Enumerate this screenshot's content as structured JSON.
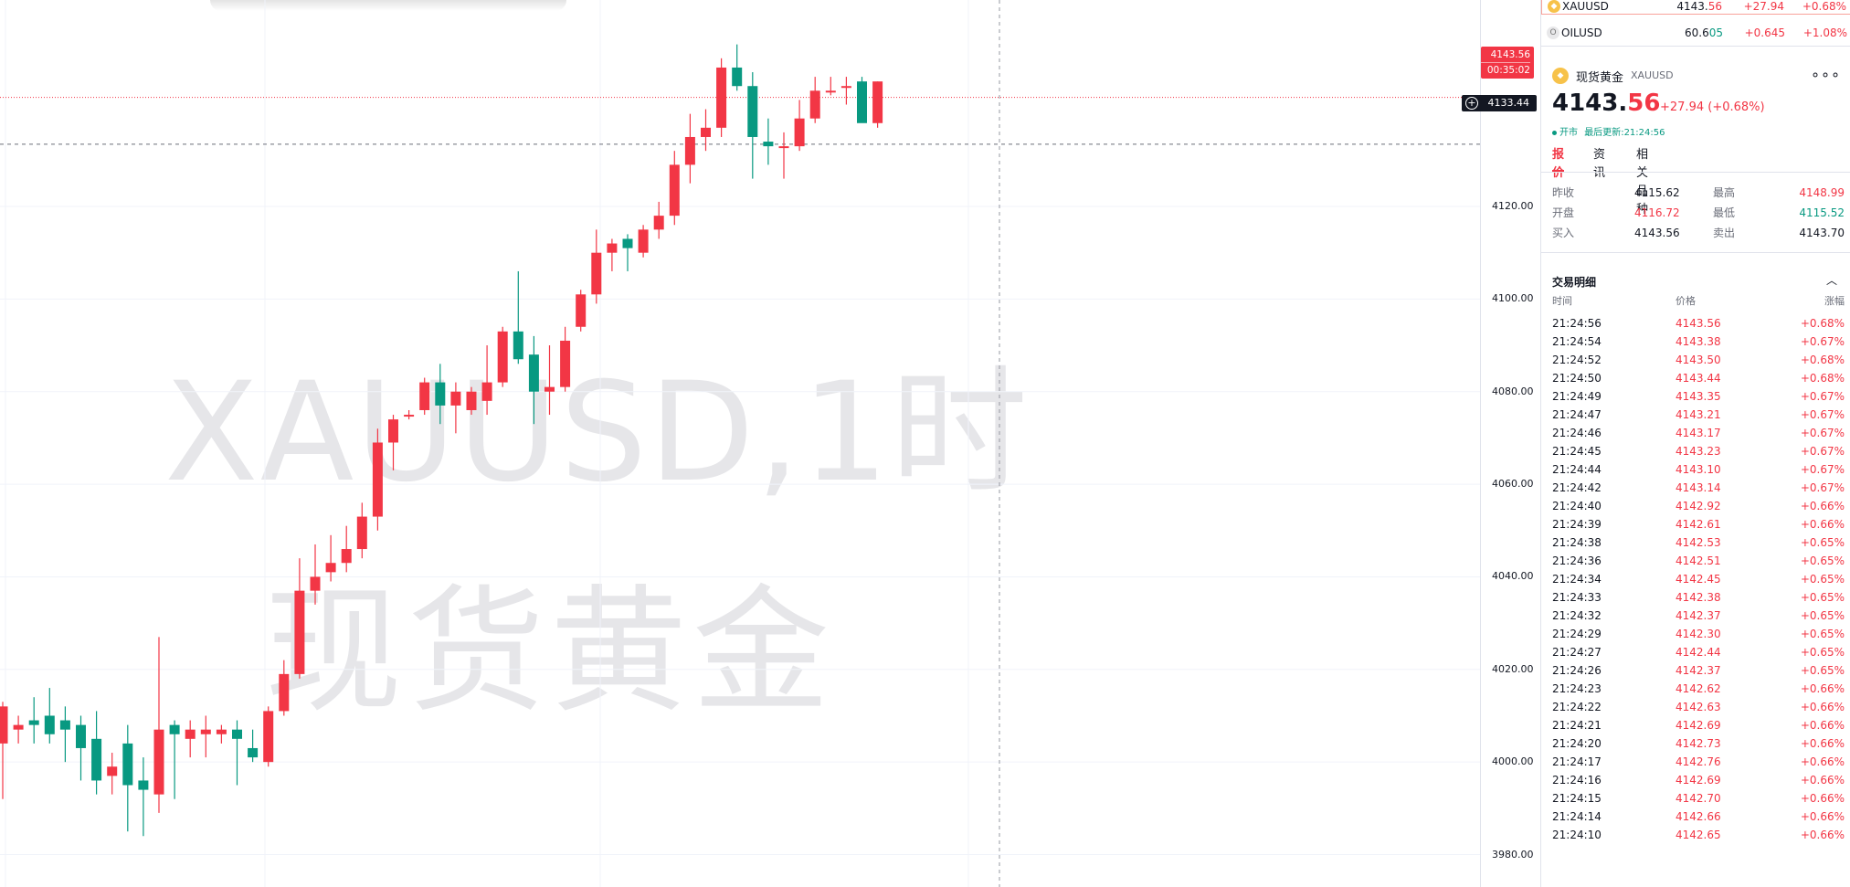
{
  "chart": {
    "symbol": "XAUUSD",
    "watermark_line1": "XAUUSD,1时",
    "watermark_line2": "现货黄金",
    "price_tag": {
      "price": "4143.56",
      "countdown": "00:35:02"
    },
    "crosshair_price": "4133.44",
    "y_ticks": [
      "4120.00",
      "4100.00",
      "4080.00",
      "4060.00",
      "4040.00",
      "4020.00",
      "4000.00",
      "3980.00"
    ],
    "colors": {
      "up": "#f23645",
      "down": "#089981",
      "grid": "#f0f3fa"
    }
  },
  "chart_data": {
    "type": "candlestick",
    "title": "XAUUSD,1时",
    "ylim": [
      3973,
      4164
    ],
    "candles": [
      {
        "o": 4004,
        "h": 4013,
        "l": 3992,
        "c": 4012
      },
      {
        "o": 4007,
        "h": 4010,
        "l": 4004,
        "c": 4008
      },
      {
        "o": 4009,
        "h": 4014,
        "l": 4004,
        "c": 4008
      },
      {
        "o": 4010,
        "h": 4016,
        "l": 4004,
        "c": 4006
      },
      {
        "o": 4009,
        "h": 4012,
        "l": 4000,
        "c": 4007
      },
      {
        "o": 4008,
        "h": 4010,
        "l": 3996,
        "c": 4003
      },
      {
        "o": 4005,
        "h": 4011,
        "l": 3993,
        "c": 3996
      },
      {
        "o": 3997,
        "h": 4002,
        "l": 3993,
        "c": 3999
      },
      {
        "o": 4004,
        "h": 4008,
        "l": 3985,
        "c": 3995
      },
      {
        "o": 3996,
        "h": 4001,
        "l": 3984,
        "c": 3994
      },
      {
        "o": 3993,
        "h": 4027,
        "l": 3989,
        "c": 4007
      },
      {
        "o": 4008,
        "h": 4009,
        "l": 3992,
        "c": 4006
      },
      {
        "o": 4005,
        "h": 4009,
        "l": 4001,
        "c": 4007
      },
      {
        "o": 4006,
        "h": 4010,
        "l": 4001,
        "c": 4007
      },
      {
        "o": 4006,
        "h": 4008,
        "l": 4004,
        "c": 4007
      },
      {
        "o": 4007,
        "h": 4009,
        "l": 3995,
        "c": 4005
      },
      {
        "o": 4003,
        "h": 4007,
        "l": 4000,
        "c": 4001
      },
      {
        "o": 4000,
        "h": 4012,
        "l": 3999,
        "c": 4011
      },
      {
        "o": 4011,
        "h": 4022,
        "l": 4010,
        "c": 4019
      },
      {
        "o": 4019,
        "h": 4044,
        "l": 4018,
        "c": 4037
      },
      {
        "o": 4037,
        "h": 4047,
        "l": 4034,
        "c": 4040
      },
      {
        "o": 4041,
        "h": 4049,
        "l": 4039,
        "c": 4043
      },
      {
        "o": 4043,
        "h": 4051,
        "l": 4041,
        "c": 4046
      },
      {
        "o": 4046,
        "h": 4056,
        "l": 4044,
        "c": 4053
      },
      {
        "o": 4053,
        "h": 4072,
        "l": 4050,
        "c": 4069
      },
      {
        "o": 4069,
        "h": 4075,
        "l": 4063,
        "c": 4074
      },
      {
        "o": 4075,
        "h": 4076,
        "l": 4074,
        "c": 4075
      },
      {
        "o": 4076,
        "h": 4083,
        "l": 4075,
        "c": 4082
      },
      {
        "o": 4082,
        "h": 4086,
        "l": 4073,
        "c": 4077
      },
      {
        "o": 4077,
        "h": 4082,
        "l": 4071,
        "c": 4080
      },
      {
        "o": 4076,
        "h": 4081,
        "l": 4075,
        "c": 4080
      },
      {
        "o": 4078,
        "h": 4090,
        "l": 4075,
        "c": 4082
      },
      {
        "o": 4082,
        "h": 4094,
        "l": 4081,
        "c": 4093
      },
      {
        "o": 4093,
        "h": 4106,
        "l": 4086,
        "c": 4087
      },
      {
        "o": 4088,
        "h": 4092,
        "l": 4073,
        "c": 4080
      },
      {
        "o": 4080,
        "h": 4090,
        "l": 4075,
        "c": 4081
      },
      {
        "o": 4081,
        "h": 4094,
        "l": 4080,
        "c": 4091
      },
      {
        "o": 4094,
        "h": 4102,
        "l": 4093,
        "c": 4101
      },
      {
        "o": 4101,
        "h": 4115,
        "l": 4099,
        "c": 4110
      },
      {
        "o": 4110,
        "h": 4113,
        "l": 4106,
        "c": 4112
      },
      {
        "o": 4113,
        "h": 4114,
        "l": 4106,
        "c": 4111
      },
      {
        "o": 4110,
        "h": 4116,
        "l": 4109,
        "c": 4115
      },
      {
        "o": 4115,
        "h": 4121,
        "l": 4113,
        "c": 4118
      },
      {
        "o": 4118,
        "h": 4132,
        "l": 4116,
        "c": 4129
      },
      {
        "o": 4129,
        "h": 4140,
        "l": 4125,
        "c": 4135
      },
      {
        "o": 4135,
        "h": 4141,
        "l": 4132,
        "c": 4137
      },
      {
        "o": 4137,
        "h": 4152,
        "l": 4135,
        "c": 4150
      },
      {
        "o": 4150,
        "h": 4155,
        "l": 4145,
        "c": 4146
      },
      {
        "o": 4146,
        "h": 4149,
        "l": 4126,
        "c": 4135
      },
      {
        "o": 4134,
        "h": 4139,
        "l": 4129,
        "c": 4133
      },
      {
        "o": 4133,
        "h": 4136,
        "l": 4126,
        "c": 4133
      },
      {
        "o": 4133,
        "h": 4143,
        "l": 4132,
        "c": 4139
      },
      {
        "o": 4139,
        "h": 4148,
        "l": 4138,
        "c": 4145
      },
      {
        "o": 4145,
        "h": 4148,
        "l": 4144,
        "c": 4145
      },
      {
        "o": 4146,
        "h": 4148,
        "l": 4142,
        "c": 4146
      },
      {
        "o": 4147,
        "h": 4148,
        "l": 4139,
        "c": 4138
      },
      {
        "o": 4138,
        "h": 4147,
        "l": 4137,
        "c": 4147
      }
    ]
  },
  "watchlist": [
    {
      "symbol": "XAUUSD",
      "last_main": "4143.",
      "last_dec": "56",
      "change": "+27.94",
      "pct": "+0.68%",
      "icon": "gold-coin-icon",
      "icon_color": "#f7c24a"
    },
    {
      "symbol": "OILUSD",
      "last_main": "60.6",
      "last_dec": "05",
      "change": "+0.645",
      "pct": "+1.08%",
      "icon": "oil-icon",
      "icon_color": "#e8e8ea"
    }
  ],
  "detail": {
    "name": "现货黄金",
    "code": "XAUUSD",
    "price_main": "4143.",
    "price_dec": "56",
    "change": "+27.94 (+0.68%)",
    "status": "开市",
    "last_update_label": "最后更新",
    "last_update_time": "21:24:56",
    "tabs": [
      "报价",
      "资讯",
      "相关品种"
    ],
    "stats": [
      {
        "l1": "昨收",
        "v1": "4115.62",
        "l2": "最高",
        "v2": "4148.99",
        "c1": "",
        "c2": "red"
      },
      {
        "l1": "开盘",
        "v1": "4116.72",
        "l2": "最低",
        "v2": "4115.52",
        "c1": "red",
        "c2": "green"
      },
      {
        "l1": "买入",
        "v1": "4143.56",
        "l2": "卖出",
        "v2": "4143.70",
        "c1": "",
        "c2": ""
      }
    ]
  },
  "trades": {
    "title": "交易明细",
    "headers": {
      "time": "时间",
      "price": "价格",
      "pct": "涨幅"
    },
    "rows": [
      [
        "21:24:56",
        "4143.56",
        "+0.68%"
      ],
      [
        "21:24:54",
        "4143.38",
        "+0.67%"
      ],
      [
        "21:24:52",
        "4143.50",
        "+0.68%"
      ],
      [
        "21:24:50",
        "4143.44",
        "+0.68%"
      ],
      [
        "21:24:49",
        "4143.35",
        "+0.67%"
      ],
      [
        "21:24:47",
        "4143.21",
        "+0.67%"
      ],
      [
        "21:24:46",
        "4143.17",
        "+0.67%"
      ],
      [
        "21:24:45",
        "4143.23",
        "+0.67%"
      ],
      [
        "21:24:44",
        "4143.10",
        "+0.67%"
      ],
      [
        "21:24:42",
        "4143.14",
        "+0.67%"
      ],
      [
        "21:24:40",
        "4142.92",
        "+0.66%"
      ],
      [
        "21:24:39",
        "4142.61",
        "+0.66%"
      ],
      [
        "21:24:38",
        "4142.53",
        "+0.65%"
      ],
      [
        "21:24:36",
        "4142.51",
        "+0.65%"
      ],
      [
        "21:24:34",
        "4142.45",
        "+0.65%"
      ],
      [
        "21:24:33",
        "4142.38",
        "+0.65%"
      ],
      [
        "21:24:32",
        "4142.37",
        "+0.65%"
      ],
      [
        "21:24:29",
        "4142.30",
        "+0.65%"
      ],
      [
        "21:24:27",
        "4142.44",
        "+0.65%"
      ],
      [
        "21:24:26",
        "4142.37",
        "+0.65%"
      ],
      [
        "21:24:23",
        "4142.62",
        "+0.66%"
      ],
      [
        "21:24:22",
        "4142.63",
        "+0.66%"
      ],
      [
        "21:24:21",
        "4142.69",
        "+0.66%"
      ],
      [
        "21:24:20",
        "4142.73",
        "+0.66%"
      ],
      [
        "21:24:17",
        "4142.76",
        "+0.66%"
      ],
      [
        "21:24:16",
        "4142.69",
        "+0.66%"
      ],
      [
        "21:24:15",
        "4142.70",
        "+0.66%"
      ],
      [
        "21:24:14",
        "4142.66",
        "+0.66%"
      ],
      [
        "21:24:10",
        "4142.65",
        "+0.66%"
      ]
    ]
  }
}
